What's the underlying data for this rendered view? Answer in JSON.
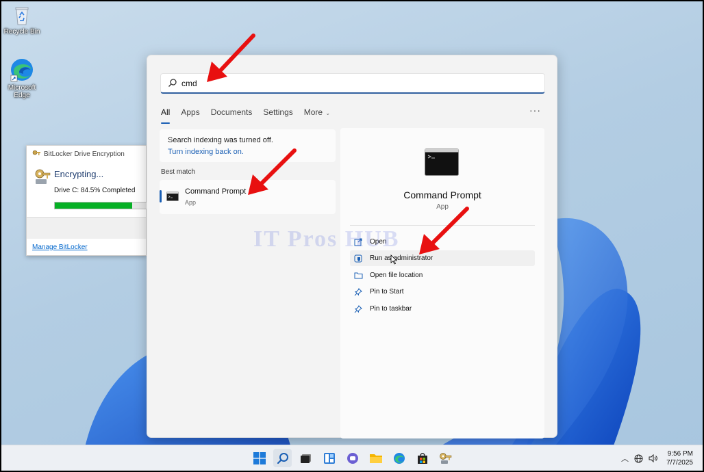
{
  "desktop": {
    "icons": [
      {
        "label": "Recycle Bin",
        "icon": "recycle-bin-icon"
      },
      {
        "label": "Microsoft Edge",
        "icon": "edge-icon"
      }
    ]
  },
  "bitlocker": {
    "title": "BitLocker Drive Encryption",
    "heading": "Encrypting...",
    "status": "Drive C: 84.5% Completed",
    "progress": 84.5,
    "link": "Manage BitLocker"
  },
  "search": {
    "query": "cmd",
    "tabs": [
      "All",
      "Apps",
      "Documents",
      "Settings",
      "More"
    ],
    "active_tab": "All",
    "more_icon": "ellipsis-icon",
    "indexing_notice": "Search indexing was turned off.",
    "indexing_link": "Turn indexing back on.",
    "best_match_label": "Best match",
    "best_match": {
      "name": "Command Prompt",
      "type": "App"
    },
    "detail": {
      "name": "Command Prompt",
      "type": "App",
      "actions": [
        {
          "label": "Open",
          "icon": "open-icon"
        },
        {
          "label": "Run as administrator",
          "icon": "shield-icon"
        },
        {
          "label": "Open file location",
          "icon": "folder-icon"
        },
        {
          "label": "Pin to Start",
          "icon": "pin-icon"
        },
        {
          "label": "Pin to taskbar",
          "icon": "pin-icon"
        }
      ]
    }
  },
  "watermark": "IT Pros HUB",
  "taskbar": {
    "apps": [
      "start",
      "search",
      "task-view",
      "widgets",
      "chat",
      "file-explorer",
      "edge",
      "store",
      "bitlocker"
    ],
    "time": "9:56 PM",
    "date": "7/7/2025"
  },
  "colors": {
    "accent": "#1a5fb4",
    "progress": "#06b025",
    "annotation_arrow": "#e81010"
  }
}
